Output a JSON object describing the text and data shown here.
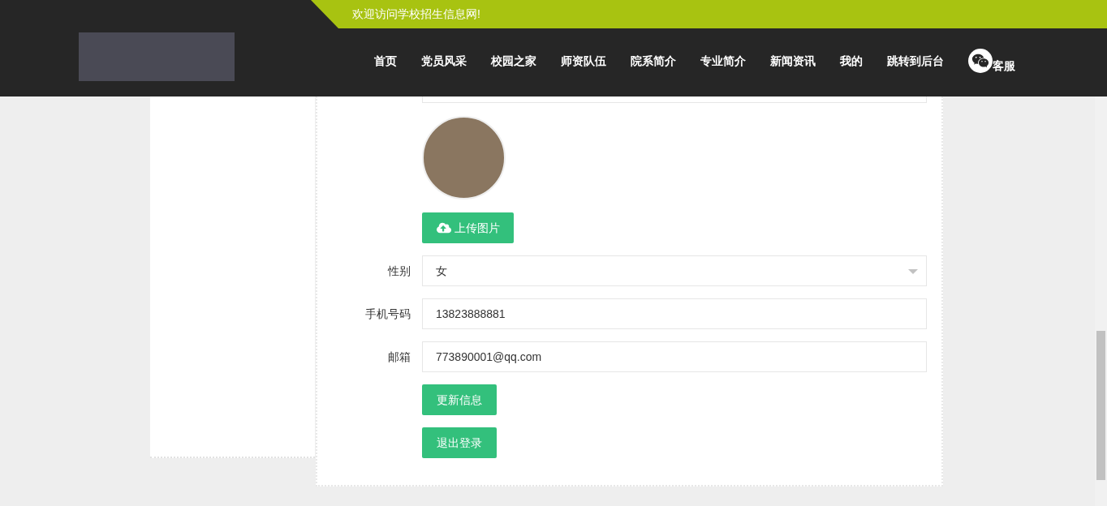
{
  "banner": {
    "text": "欢迎访问学校招生信息网!"
  },
  "nav": {
    "items": [
      {
        "label": "首页"
      },
      {
        "label": "党员风采"
      },
      {
        "label": "校园之家"
      },
      {
        "label": "师资队伍"
      },
      {
        "label": "院系简介"
      },
      {
        "label": "专业简介"
      },
      {
        "label": "新闻资讯"
      },
      {
        "label": "我的"
      },
      {
        "label": "跳转到后台"
      }
    ],
    "service": {
      "label": "客服"
    }
  },
  "form": {
    "upload_button": "上传图片",
    "fields": [
      {
        "kind": "select",
        "label": "性别",
        "value": "女"
      },
      {
        "kind": "text",
        "label": "手机号码",
        "value": "13823888881"
      },
      {
        "kind": "text",
        "label": "邮箱",
        "value": "773890001@qq.com"
      }
    ],
    "buttons": [
      "更新信息",
      "退出登录"
    ]
  }
}
